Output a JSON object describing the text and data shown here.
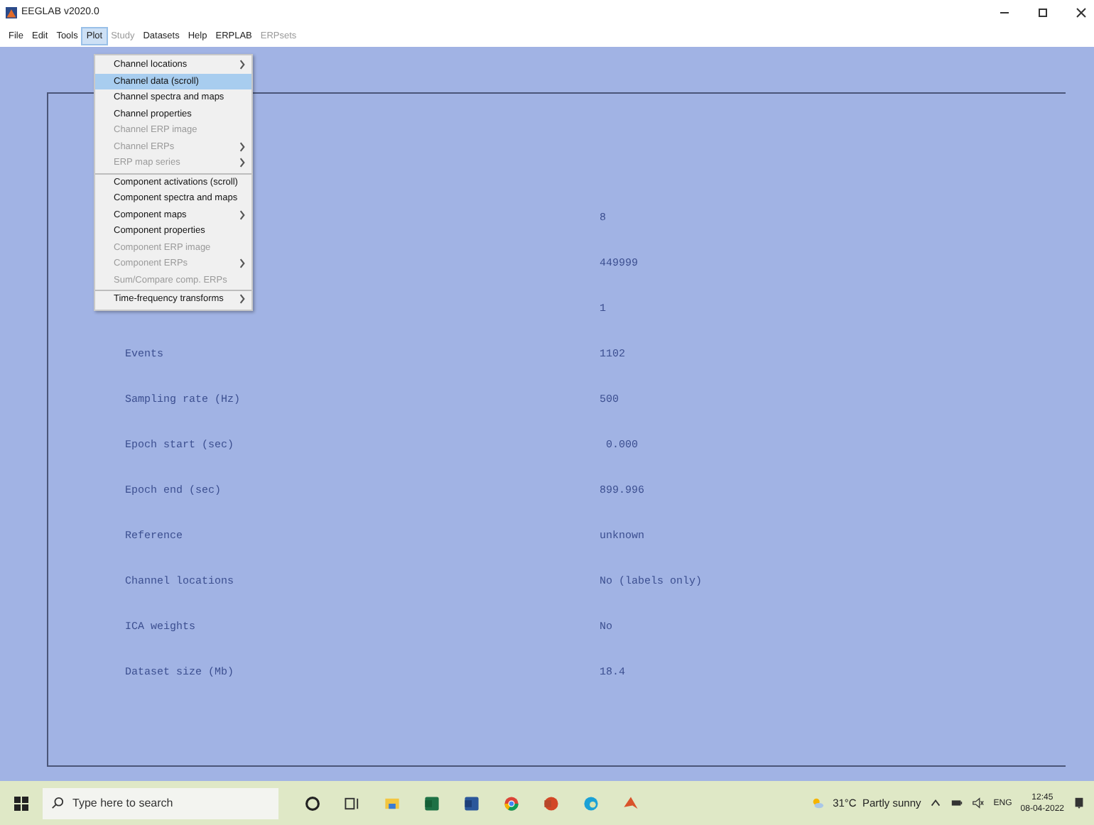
{
  "window": {
    "title": "EEGLAB v2020.0"
  },
  "menu_bar": [
    {
      "label": "File",
      "selected": false,
      "disabled": false
    },
    {
      "label": "Edit",
      "selected": false,
      "disabled": false
    },
    {
      "label": "Tools",
      "selected": false,
      "disabled": false
    },
    {
      "label": "Plot",
      "selected": true,
      "disabled": false
    },
    {
      "label": "Study",
      "selected": false,
      "disabled": true
    },
    {
      "label": "Datasets",
      "selected": false,
      "disabled": false
    },
    {
      "label": "Help",
      "selected": false,
      "disabled": false
    },
    {
      "label": "ERPLAB",
      "selected": false,
      "disabled": false
    },
    {
      "label": "ERPsets",
      "selected": false,
      "disabled": true
    }
  ],
  "plot_menu": [
    {
      "label": "Channel locations",
      "submenu": true,
      "disabled": false,
      "selected": false,
      "separator_before": false
    },
    {
      "label": "Channel data (scroll)",
      "submenu": false,
      "disabled": false,
      "selected": true,
      "separator_before": false
    },
    {
      "label": "Channel spectra and maps",
      "submenu": false,
      "disabled": false,
      "selected": false,
      "separator_before": false
    },
    {
      "label": "Channel properties",
      "submenu": false,
      "disabled": false,
      "selected": false,
      "separator_before": false
    },
    {
      "label": "Channel ERP image",
      "submenu": false,
      "disabled": true,
      "selected": false,
      "separator_before": false
    },
    {
      "label": "Channel ERPs",
      "submenu": true,
      "disabled": true,
      "selected": false,
      "separator_before": false
    },
    {
      "label": "ERP map series",
      "submenu": true,
      "disabled": true,
      "selected": false,
      "separator_before": false
    },
    {
      "label": "Component activations (scroll)",
      "submenu": false,
      "disabled": false,
      "selected": false,
      "separator_before": true
    },
    {
      "label": "Component spectra and maps",
      "submenu": false,
      "disabled": false,
      "selected": false,
      "separator_before": false
    },
    {
      "label": "Component maps",
      "submenu": true,
      "disabled": false,
      "selected": false,
      "separator_before": false
    },
    {
      "label": "Component properties",
      "submenu": false,
      "disabled": false,
      "selected": false,
      "separator_before": false
    },
    {
      "label": "Component ERP image",
      "submenu": false,
      "disabled": true,
      "selected": false,
      "separator_before": false
    },
    {
      "label": "Component ERPs",
      "submenu": true,
      "disabled": true,
      "selected": false,
      "separator_before": false
    },
    {
      "label": "Sum/Compare comp. ERPs",
      "submenu": false,
      "disabled": true,
      "selected": false,
      "separator_before": false
    },
    {
      "label": "Time-frequency transforms",
      "submenu": true,
      "disabled": false,
      "selected": false,
      "separator_before": true
    }
  ],
  "dataset_info": [
    {
      "value": "8"
    },
    {
      "value": "449999"
    },
    {
      "value": "1"
    },
    {
      "label": "Events",
      "value": "1102"
    },
    {
      "label": "Sampling rate (Hz)",
      "value": "500"
    },
    {
      "label": "Epoch start (sec)",
      "value": " 0.000"
    },
    {
      "label": "Epoch end (sec)",
      "value": "899.996"
    },
    {
      "label": "Reference",
      "value": "unknown"
    },
    {
      "label": "Channel locations",
      "value": "No (labels only)"
    },
    {
      "label": "ICA weights",
      "value": "No"
    },
    {
      "label": "Dataset size (Mb)",
      "value": "18.4"
    }
  ],
  "taskbar": {
    "search": {
      "placeholder": "Type here to search"
    },
    "weather": "31°C  Partly sunny",
    "language": "ENG",
    "time": "12:45",
    "date": "08-04-2022"
  }
}
